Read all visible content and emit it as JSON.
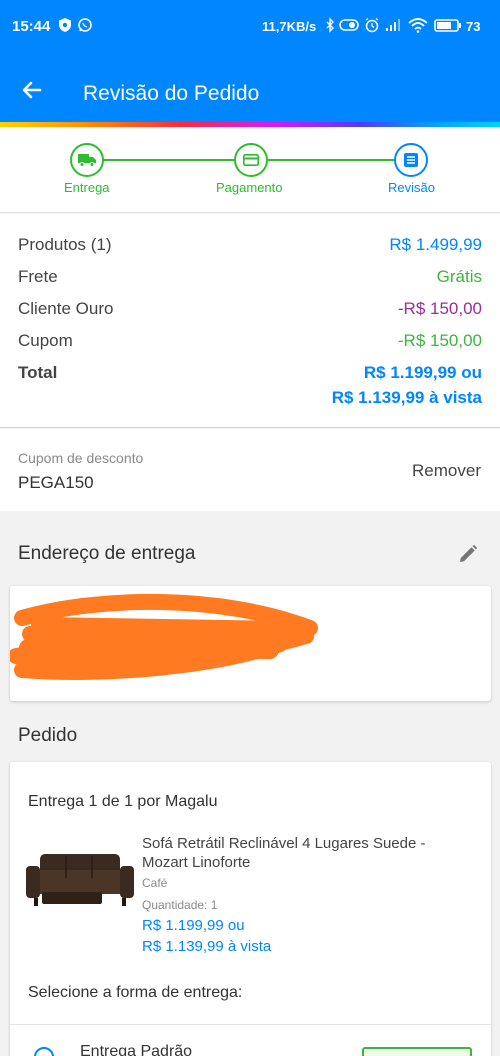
{
  "status_bar": {
    "time": "15:44",
    "net_speed": "11,7KB/s",
    "battery": "73"
  },
  "header": {
    "title": "Revisão do Pedido"
  },
  "stepper": {
    "steps": [
      {
        "label": "Entrega",
        "state": "done"
      },
      {
        "label": "Pagamento",
        "state": "done"
      },
      {
        "label": "Revisão",
        "state": "current"
      }
    ]
  },
  "summary": {
    "rows": [
      {
        "label": "Produtos (1)",
        "value": "R$ 1.499,99"
      },
      {
        "label": "Frete",
        "value": "Grátis"
      },
      {
        "label": "Cliente Ouro",
        "value": "-R$ 150,00"
      },
      {
        "label": "Cupom",
        "value": "-R$ 150,00"
      }
    ],
    "total_label": "Total",
    "total_value": "R$ 1.199,99 ou",
    "total_cash": "R$ 1.139,99 à vista"
  },
  "coupon": {
    "caption": "Cupom de desconto",
    "code": "PEGA150",
    "remove_label": "Remover"
  },
  "address": {
    "title": "Endereço de entrega",
    "redacted": true
  },
  "order": {
    "title": "Pedido",
    "delivery_title": "Entrega 1 de 1 por Magalu",
    "product": {
      "name": "Sofá Retrátil Reclinável 4 Lugares Suede - Mozart Linoforte",
      "color": "Café",
      "quantity": "Quantidade:  1",
      "price": "R$ 1.199,99 ou",
      "cash_price": "R$ 1.139,99 à vista"
    },
    "select_shipping": "Selecione a forma de entrega:",
    "shipping_option": "Entrega Padrão"
  },
  "colors": {
    "primary": "#0086ff",
    "success": "#3db53d",
    "discount": "#9b2d9b",
    "redaction": "#ff7a21"
  }
}
